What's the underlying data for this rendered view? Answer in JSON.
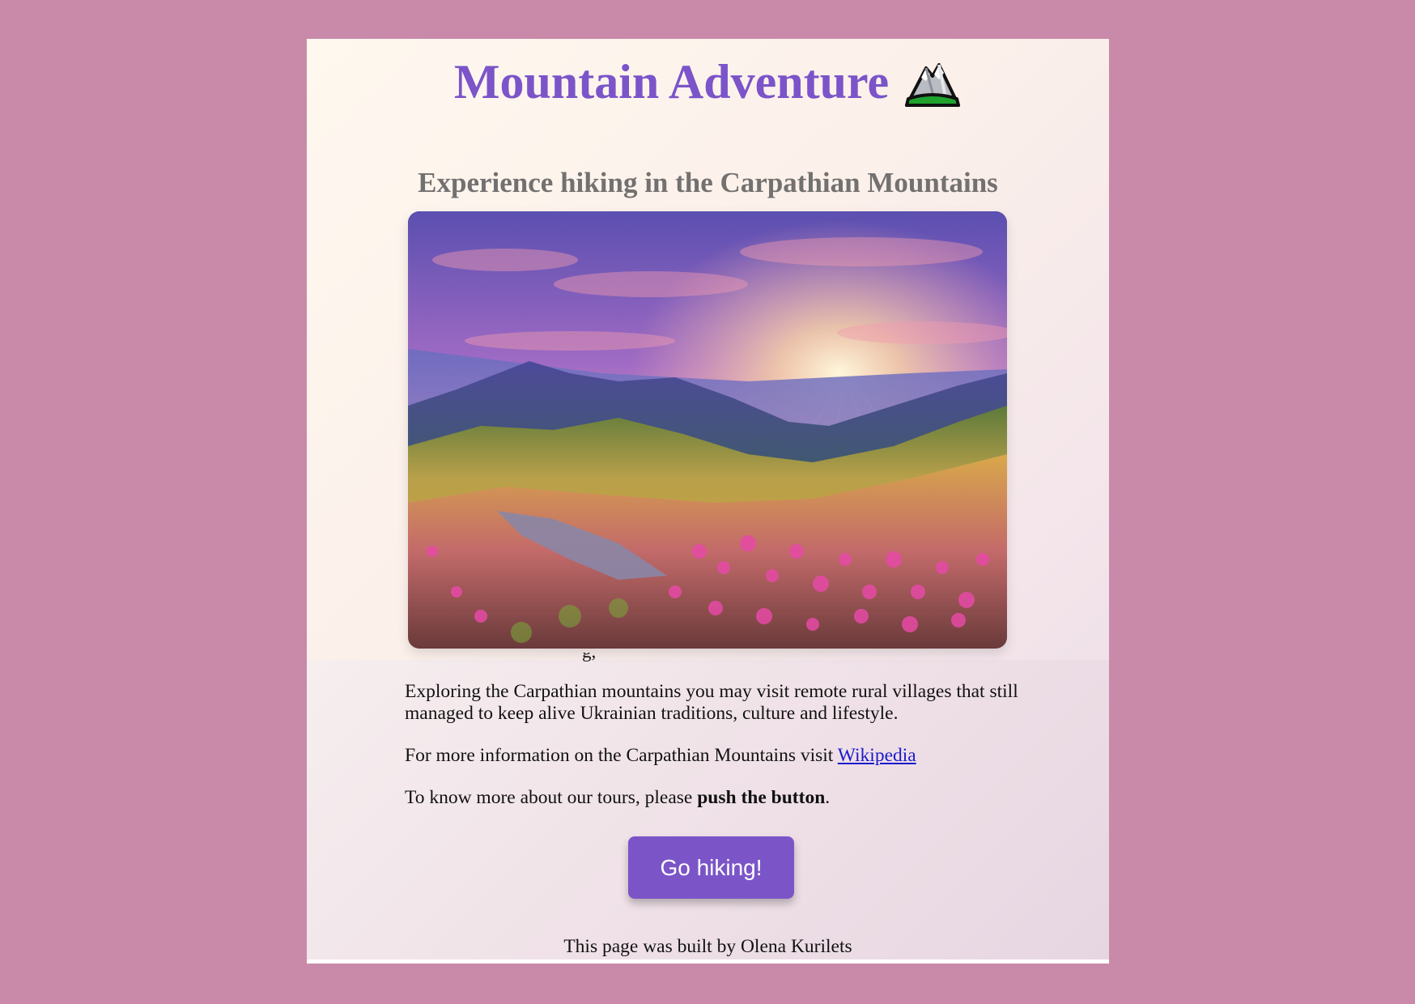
{
  "page": {
    "background_color": "#c98aa9",
    "accent_color": "#7b55c8"
  },
  "header": {
    "title": "Mountain Adventure",
    "title_icon": "snow-capped-mountain-icon",
    "subtitle": "Experience hiking in the Carpathian Mountains"
  },
  "hero_image": {
    "description_icon": "mountain-sunset-photo"
  },
  "content": {
    "peek_text": "g,",
    "paragraph1": "Exploring the Carpathian mountains you may visit remote rural villages that still managed to keep alive Ukrainian traditions, culture and lifestyle.",
    "paragraph2_prefix": "For more information on the Carpathian Mountains visit ",
    "wikipedia_link": "Wikipedia",
    "paragraph3_prefix": "To know more about our tours, please ",
    "paragraph3_bold": "push the button",
    "paragraph3_suffix": "."
  },
  "button": {
    "label": "Go hiking!"
  },
  "footer": {
    "text": "This page was built by Olena Kurilets"
  }
}
